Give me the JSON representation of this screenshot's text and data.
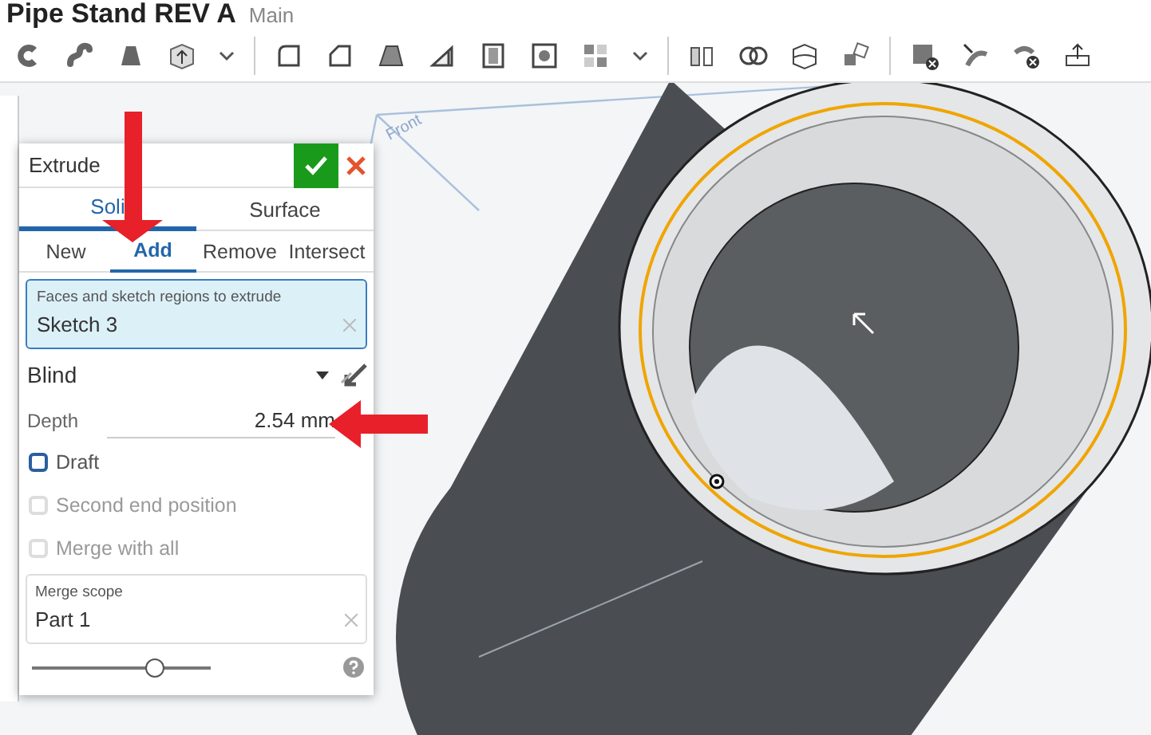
{
  "document": {
    "title": "Pipe Stand REV A",
    "branch": "Main"
  },
  "viewport": {
    "plane_label": "Front"
  },
  "feature_dialog": {
    "title": "Extrude",
    "body_types": [
      {
        "label": "Soli",
        "selected": true
      },
      {
        "label": "Surface",
        "selected": false
      }
    ],
    "operations": [
      {
        "label": "New",
        "selected": false
      },
      {
        "label": "Add",
        "selected": true
      },
      {
        "label": "Remove",
        "selected": false
      },
      {
        "label": "Intersect",
        "selected": false
      }
    ],
    "selection_field": {
      "label": "Faces and sketch regions to extrude",
      "value": "Sketch 3"
    },
    "end_type": "Blind",
    "depth": {
      "label": "Depth",
      "value": "2.54 mm"
    },
    "options": [
      {
        "label": "Draft",
        "checked": false,
        "disabled": false
      },
      {
        "label": "Second end position",
        "checked": false,
        "disabled": true
      },
      {
        "label": "Merge with all",
        "checked": false,
        "disabled": true
      }
    ],
    "merge_scope": {
      "label": "Merge scope",
      "value": "Part 1"
    },
    "slider": {
      "level": 0.69
    }
  }
}
